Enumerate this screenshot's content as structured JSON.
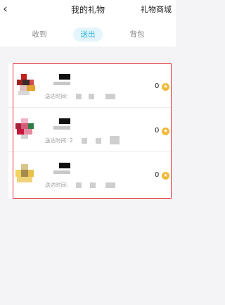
{
  "header": {
    "back_glyph": "‹",
    "title": "我的礼物",
    "store": "礼物商城"
  },
  "tabs": [
    {
      "label": "收到"
    },
    {
      "label": "送出",
      "active": true
    },
    {
      "label": "背包"
    }
  ],
  "gifts": [
    {
      "time_label": "送达时间:",
      "count": "0",
      "coin_icon": "coin-icon"
    },
    {
      "time_label": "送达时间: 2",
      "count": "0",
      "coin_icon": "coin-icon"
    },
    {
      "time_label": "送达时间:",
      "count": "0",
      "coin_icon": "coin-icon"
    }
  ],
  "colors": {
    "accent": "#2ab3de",
    "tab_active_bg": "#e4f6fc",
    "highlight_frame": "#e8353a",
    "coin": "#f0b93a"
  }
}
